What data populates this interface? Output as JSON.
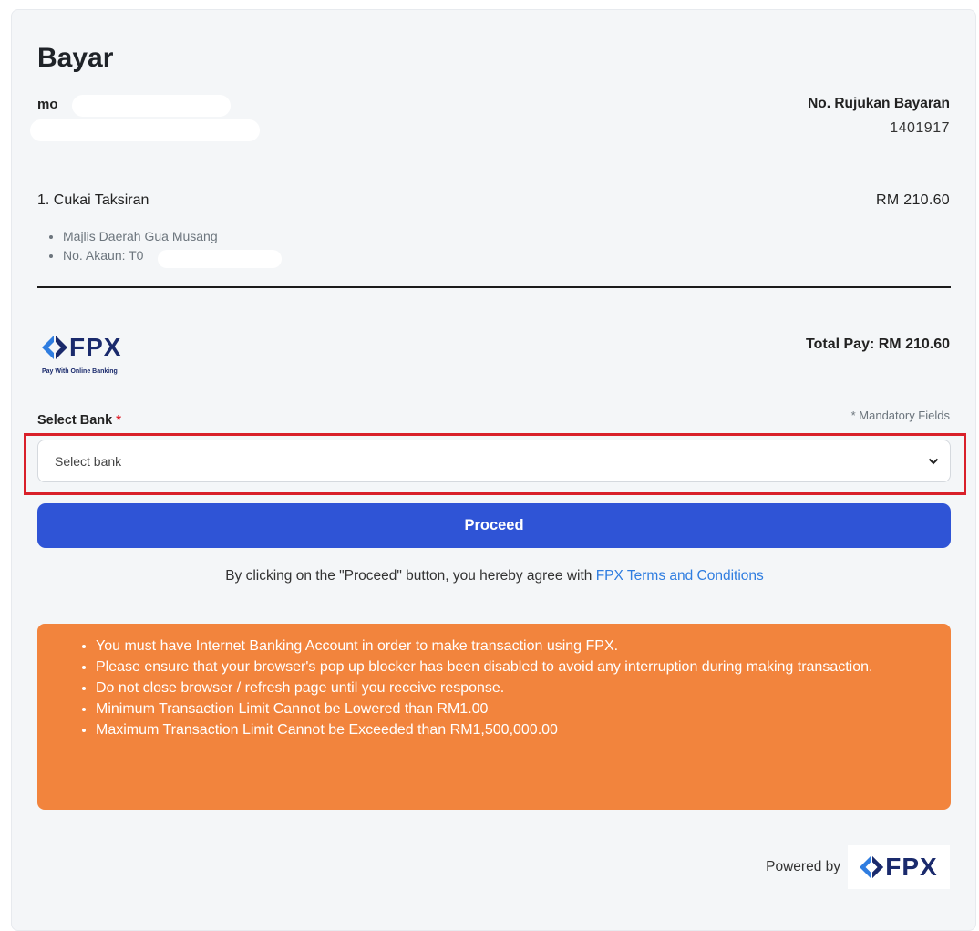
{
  "page": {
    "title": "Bayar",
    "payer_name": "mo"
  },
  "reference": {
    "label": "No. Rujukan Bayaran",
    "value": "1401917"
  },
  "item": {
    "title": "1. Cukai Taksiran",
    "amount": "RM 210.60",
    "details": [
      "Majlis Daerah Gua Musang",
      "No. Akaun: T0"
    ]
  },
  "payment": {
    "method_logo_text": "FPX",
    "method_tagline": "Pay With Online Banking",
    "total": "Total Pay: RM 210.60"
  },
  "bank_select": {
    "label": "Select Bank",
    "required_marker": "*",
    "mandatory_note": "* Mandatory Fields",
    "selected_value": "Select bank"
  },
  "actions": {
    "proceed_label": "Proceed"
  },
  "agreement": {
    "text": "By clicking on the \"Proceed\" button, you hereby agree with ",
    "link_text": "FPX Terms and Conditions"
  },
  "notices": [
    "You must have Internet Banking Account in order to make transaction using FPX.",
    "Please ensure that your browser's pop up blocker has been disabled to avoid any interruption during making transaction.",
    "Do not close browser / refresh page until you receive response.",
    "Minimum Transaction Limit Cannot be Lowered than RM1.00",
    "Maximum Transaction Limit Cannot be Exceeded than RM1,500,000.00"
  ],
  "footer": {
    "powered_by": "Powered by",
    "logo_text": "FPX"
  },
  "colors": {
    "accent": "#2f54d6",
    "notice_bg": "#f2843d",
    "highlight": "#d9202a",
    "link": "#2f7de0"
  },
  "icons": {
    "fpx_logo": "fpx-logo-icon",
    "select_caret": "chevron-down-icon"
  }
}
